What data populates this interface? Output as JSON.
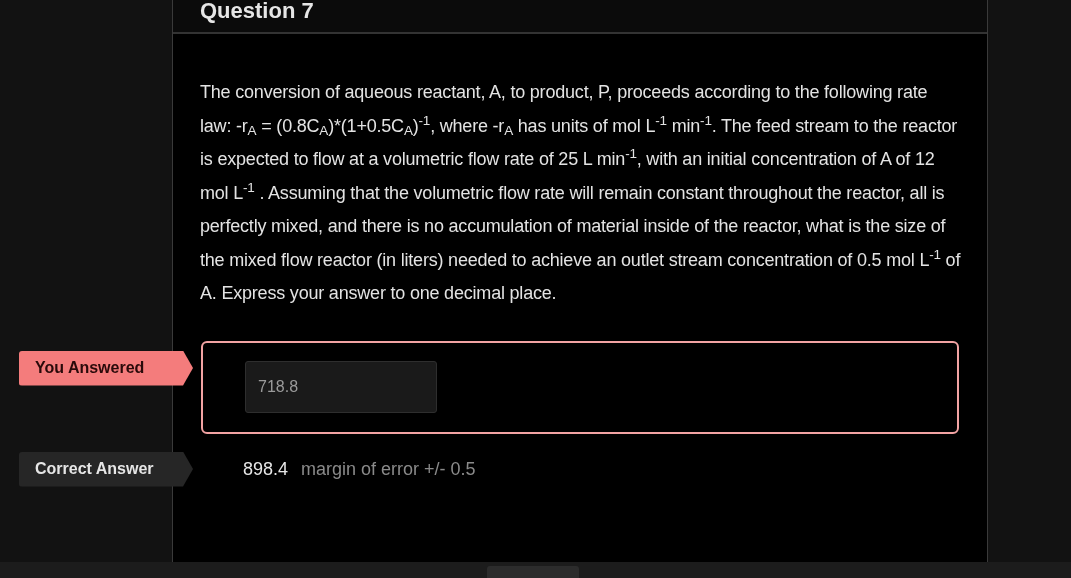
{
  "header": {
    "title": "Question 7"
  },
  "question": {
    "text": "The conversion of aqueous reactant, A, to product, P, proceeds according to the following rate law: -r$_{A}$ = (0.8C$_{A}$)*(1+0.5C$_{A}$)$^{-1}$, where -r$_{A}$ has units of mol L$^{-1}$ min$^{-1}$. The feed stream to the reactor is expected to flow at a volumetric flow rate of 25 L min$^{-1}$, with an initial concentration of A of 12 mol L$^{-1}$ . Assuming that the volumetric flow rate will remain constant throughout the reactor, all is perfectly mixed, and there is no accumulation of material inside of the reactor, what is the  size of the mixed flow reactor (in liters) needed to achieve an outlet stream concentration of 0.5 mol L$^{-1}$ of A. Express your answer to one decimal place."
  },
  "answers": [
    {
      "kind": "given",
      "label": "You Answered",
      "value": "718.8"
    },
    {
      "kind": "correct",
      "label": "Correct Answer",
      "value": "898.4",
      "note": "margin of error +/- 0.5"
    }
  ]
}
